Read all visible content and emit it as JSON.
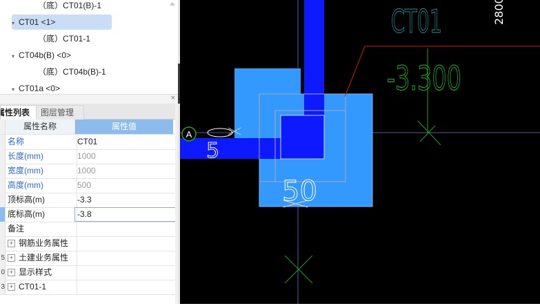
{
  "tree": {
    "items": [
      {
        "label": "（底）CT01(B)-1",
        "arrow": "",
        "selected": false
      },
      {
        "label": "CT01 <1>",
        "arrow": "▾",
        "selected": true
      },
      {
        "label": "（底）CT01-1",
        "arrow": "",
        "selected": false
      },
      {
        "label": "CT04b(B) <0>",
        "arrow": "▾",
        "selected": false
      },
      {
        "label": "（底）CT04b(B)-1",
        "arrow": "",
        "selected": false
      },
      {
        "label": "CT01a <0>",
        "arrow": "▾",
        "selected": false
      }
    ]
  },
  "panel": {
    "close": "×",
    "tabs": [
      "属性列表",
      "图层管理"
    ]
  },
  "properties": {
    "header": {
      "name": "属性名称",
      "value": "属性值"
    },
    "rows": [
      {
        "num": "",
        "name": "名称",
        "value": "CT01"
      },
      {
        "num": "",
        "name": "长度(mm)",
        "value": "1000"
      },
      {
        "num": "",
        "name": "宽度(mm)",
        "value": "1000"
      },
      {
        "num": "",
        "name": "高度(mm)",
        "value": "500"
      },
      {
        "num": "",
        "name": "顶标高(m)",
        "value": "-3.3"
      },
      {
        "num": "",
        "name": "底标高(m)",
        "value": "-3.8"
      },
      {
        "num": "",
        "name": "备注",
        "value": ""
      },
      {
        "num": "",
        "name": "钢筋业务属性",
        "value": ""
      },
      {
        "num": "5",
        "name": "土建业务属性",
        "value": ""
      },
      {
        "num": "0",
        "name": "显示样式",
        "value": ""
      },
      {
        "num": "3",
        "name": "CT01-1",
        "value": ""
      }
    ]
  },
  "cad": {
    "label_name": "CT01",
    "label_elev": "-3.300",
    "top_right_dim": "2800",
    "axis_label": "A",
    "dim_50": "50",
    "dim_5": "5"
  },
  "colors": {
    "canvas_bg": "#000000",
    "pile_cap_fill": "#3399ff",
    "beam_fill": "#0d1aff",
    "green_line": "#1fa21f",
    "red_leader": "#d01818",
    "header_value_bg": "#8cbcee",
    "tree_selected_bg": "#c9ddf5",
    "property_name_blue": "#2b6bd6"
  }
}
